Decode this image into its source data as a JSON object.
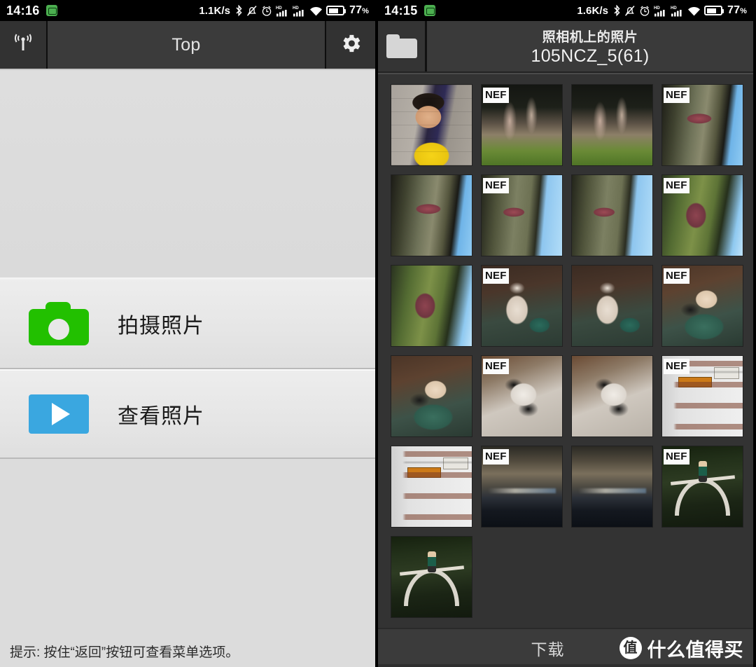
{
  "left": {
    "statusbar": {
      "time": "14:16",
      "app_icon": "android-app-icon",
      "net_speed": "1.1K/s",
      "icons": [
        "bluetooth-icon",
        "mute-bell-icon",
        "alarm-clock-icon",
        "hd-signal-icon",
        "hd-signal-icon",
        "wifi-icon"
      ],
      "battery_percent": "77",
      "percent_symbol": "%"
    },
    "header": {
      "wifi_button": "wireless-icon",
      "title": "Top",
      "settings_button": "gear-icon"
    },
    "menu": [
      {
        "icon": "camera-icon",
        "label": "拍摄照片",
        "color": "#22c000"
      },
      {
        "icon": "play-icon",
        "label": "查看照片",
        "color": "#3aa7e0"
      }
    ],
    "footer_hint": "提示: 按住“返回”按钮可查看菜单选项。"
  },
  "right": {
    "statusbar": {
      "time": "14:15",
      "app_icon": "android-app-icon",
      "net_speed": "1.6K/s",
      "icons": [
        "bluetooth-icon",
        "mute-bell-icon",
        "alarm-clock-icon",
        "hd-signal-icon",
        "hd-signal-icon",
        "wifi-icon"
      ],
      "battery_percent": "77",
      "percent_symbol": "%"
    },
    "header": {
      "folder_button": "folder-icon",
      "title_line1": "照相机上的照片",
      "title_line2": "105NCZ_5(61)"
    },
    "grid": {
      "columns": 4,
      "badge_label": "NEF",
      "items": [
        {
          "art": "boy",
          "nef": false
        },
        {
          "art": "grass",
          "nef": true
        },
        {
          "art": "grass",
          "nef": false
        },
        {
          "art": "rock",
          "nef": true
        },
        {
          "art": "rock",
          "nef": false
        },
        {
          "art": "rock2",
          "nef": true
        },
        {
          "art": "rock2",
          "nef": false
        },
        {
          "art": "rock3",
          "nef": true
        },
        {
          "art": "rock3",
          "nef": false
        },
        {
          "art": "cat1",
          "nef": true
        },
        {
          "art": "cat1",
          "nef": false
        },
        {
          "art": "cat2",
          "nef": true
        },
        {
          "art": "cat2",
          "nef": false
        },
        {
          "art": "cat3",
          "nef": true
        },
        {
          "art": "cat3",
          "nef": false
        },
        {
          "art": "sign",
          "nef": true
        },
        {
          "art": "sign",
          "nef": false
        },
        {
          "art": "stream",
          "nef": true
        },
        {
          "art": "stream",
          "nef": false
        },
        {
          "art": "bridge",
          "nef": true
        },
        {
          "art": "bridge",
          "nef": false
        }
      ]
    },
    "footer": {
      "download_label": "下载",
      "watermark_badge": "值",
      "watermark_text": "什么值得买"
    }
  }
}
